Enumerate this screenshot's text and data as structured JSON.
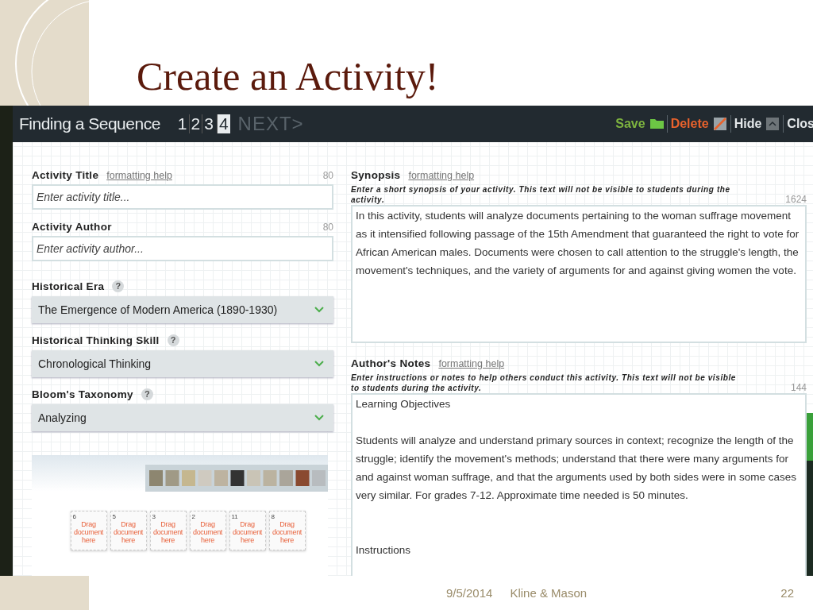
{
  "slide": {
    "title": "Create an Activity!",
    "footer": {
      "date": "9/5/2014",
      "author": "Kline & Mason",
      "page": "22"
    }
  },
  "app": {
    "header": {
      "title": "Finding a Sequence",
      "steps": [
        {
          "label": "1",
          "selected": false
        },
        {
          "label": "2",
          "selected": false
        },
        {
          "label": "3",
          "selected": false
        },
        {
          "label": "4",
          "selected": true
        }
      ],
      "next": "NEXT>",
      "actions": [
        {
          "kind": "save",
          "label": "Save"
        },
        {
          "kind": "delete",
          "label": "Delete"
        },
        {
          "kind": "hide",
          "label": "Hide"
        },
        {
          "kind": "close",
          "label": "Clos"
        }
      ]
    },
    "left_fields": [
      {
        "kind": "text",
        "label": "Activity Title",
        "help_link": "formatting help",
        "counter": "80",
        "placeholder": "Enter activity title..."
      },
      {
        "kind": "text",
        "label": "Activity Author",
        "counter": "80",
        "placeholder": "Enter activity author..."
      },
      {
        "kind": "select",
        "label": "Historical Era",
        "help_icon": "?",
        "value": "The Emergence of Modern America (1890-1930)"
      },
      {
        "kind": "select",
        "label": "Historical Thinking Skill",
        "help_icon": "?",
        "value": "Chronological Thinking"
      },
      {
        "kind": "select",
        "label": "Bloom's Taxonomy",
        "help_icon": "?",
        "value": "Analyzing"
      }
    ],
    "preview": {
      "cards": [
        {
          "number": "6",
          "text": "Drag document here"
        },
        {
          "number": "5",
          "text": "Drag document here"
        },
        {
          "number": "3",
          "text": "Drag document here"
        },
        {
          "number": "2",
          "text": "Drag document here"
        },
        {
          "number": "11",
          "text": "Drag document here"
        },
        {
          "number": "8",
          "text": "Drag document here"
        }
      ]
    },
    "right_fields": [
      {
        "label": "Synopsis",
        "help_link": "formatting help",
        "hint": "Enter a short synopsis of your activity. This text will not be visible to students during the activity.",
        "counter": "1624",
        "value": "In this activity, students will analyze documents pertaining to the woman suffrage movement as it intensified following passage of the 15th Amendment that guaranteed the right to vote for African American males. Documents were chosen to call attention to the struggle's length, the movement's techniques, and the variety of arguments for and against giving women the vote."
      },
      {
        "label": "Author's Notes",
        "help_link": "formatting help",
        "hint": "Enter instructions or notes to help others conduct this activity. This text will not be visible to students during the activity.",
        "counter": "144",
        "value": "Learning Objectives\n\nStudents will analyze and understand primary sources in context; recognize the length of the struggle; identify the movement's methods; understand that there were many arguments for and against woman suffrage, and that the arguments used by both sides were in some cases very similar. For grades 7-12. Approximate time needed is 50 minutes.\n\n\nInstructions"
      }
    ]
  }
}
